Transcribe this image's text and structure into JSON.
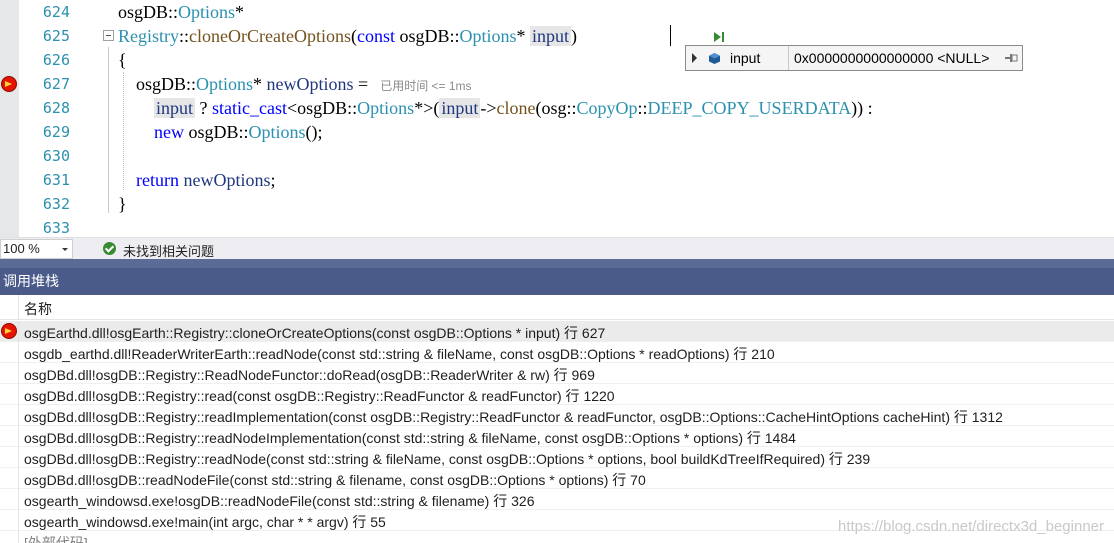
{
  "editor": {
    "lines": [
      {
        "num": "624",
        "parts": [
          {
            "c": "m",
            "t": "osgDB::"
          },
          {
            "c": "t",
            "t": "Options"
          },
          {
            "c": "m",
            "t": "*"
          }
        ]
      },
      {
        "num": "625",
        "parts": [
          {
            "c": "t",
            "t": "Registry"
          },
          {
            "c": "m",
            "t": "::"
          },
          {
            "c": "f",
            "t": "cloneOrCreateOptions"
          },
          {
            "c": "m",
            "t": "("
          },
          {
            "c": "k",
            "t": "const "
          },
          {
            "c": "m",
            "t": "osgDB::"
          },
          {
            "c": "t",
            "t": "Options"
          },
          {
            "c": "m",
            "t": "* "
          },
          {
            "c": "v",
            "t": "input"
          },
          {
            "c": "m",
            "t": ")"
          }
        ]
      },
      {
        "num": "626",
        "parts": [
          {
            "c": "m",
            "t": "{"
          }
        ]
      },
      {
        "num": "627",
        "parts": [
          {
            "c": "m",
            "t": "    osgDB::"
          },
          {
            "c": "t",
            "t": "Options"
          },
          {
            "c": "m",
            "t": "* "
          },
          {
            "c": "p",
            "t": "newOptions"
          },
          {
            "c": "m",
            "t": " ="
          }
        ]
      },
      {
        "num": "628",
        "parts": [
          {
            "c": "m",
            "t": "        "
          },
          {
            "c": "v",
            "t": "input"
          },
          {
            "c": "m",
            "t": " ? "
          },
          {
            "c": "k",
            "t": "static_cast"
          },
          {
            "c": "m",
            "t": "<osgDB::"
          },
          {
            "c": "t",
            "t": "Options"
          },
          {
            "c": "m",
            "t": "*>("
          },
          {
            "c": "v",
            "t": "input"
          },
          {
            "c": "m",
            "t": "->"
          },
          {
            "c": "f",
            "t": "clone"
          },
          {
            "c": "m",
            "t": "(osg::"
          },
          {
            "c": "t",
            "t": "CopyOp"
          },
          {
            "c": "m",
            "t": "::"
          },
          {
            "c": "t",
            "t": "DEEP_COPY_USERDATA"
          },
          {
            "c": "m",
            "t": ")) :"
          }
        ]
      },
      {
        "num": "629",
        "parts": [
          {
            "c": "m",
            "t": "        "
          },
          {
            "c": "k",
            "t": "new"
          },
          {
            "c": "m",
            "t": " osgDB::"
          },
          {
            "c": "t",
            "t": "Options"
          },
          {
            "c": "m",
            "t": "();"
          }
        ]
      },
      {
        "num": "630",
        "parts": []
      },
      {
        "num": "631",
        "parts": [
          {
            "c": "m",
            "t": "    "
          },
          {
            "c": "k",
            "t": "return"
          },
          {
            "c": "m",
            "t": " "
          },
          {
            "c": "p",
            "t": "newOptions"
          },
          {
            "c": "m",
            "t": ";"
          }
        ]
      },
      {
        "num": "632",
        "parts": [
          {
            "c": "m",
            "t": "}"
          }
        ]
      },
      {
        "num": "633",
        "parts": []
      }
    ],
    "perf_tip": "已用时间 <= 1ms",
    "datatip": {
      "name": "input",
      "value": "0x0000000000000000 <NULL>"
    }
  },
  "status": {
    "zoom": "100 %",
    "issues": "未找到相关问题"
  },
  "call_stack": {
    "title": "调用堆栈",
    "column_name": "名称",
    "frames": [
      "osgEarthd.dll!osgEarth::Registry::cloneOrCreateOptions(const osgDB::Options * input) 行 627",
      "osgdb_earthd.dll!ReaderWriterEarth::readNode(const std::string & fileName, const osgDB::Options * readOptions) 行 210",
      "osgDBd.dll!osgDB::Registry::ReadNodeFunctor::doRead(osgDB::ReaderWriter & rw) 行 969",
      "osgDBd.dll!osgDB::Registry::read(const osgDB::Registry::ReadFunctor & readFunctor) 行 1220",
      "osgDBd.dll!osgDB::Registry::readImplementation(const osgDB::Registry::ReadFunctor & readFunctor, osgDB::Options::CacheHintOptions cacheHint) 行 1312",
      "osgDBd.dll!osgDB::Registry::readNodeImplementation(const std::string & fileName, const osgDB::Options * options) 行 1484",
      "osgDBd.dll!osgDB::Registry::readNode(const std::string & fileName, const osgDB::Options * options, bool buildKdTreeIfRequired) 行 239",
      "osgDBd.dll!osgDB::readNodeFile(const std::string & filename, const osgDB::Options * options) 行 70",
      "osgearth_windowsd.exe!osgDB::readNodeFile(const std::string & filename) 行 326",
      "osgearth_windowsd.exe!main(int argc, char * * argv) 行 55",
      "[外部代码]"
    ]
  },
  "watermark": "https://blog.csdn.net/directx3d_beginner"
}
